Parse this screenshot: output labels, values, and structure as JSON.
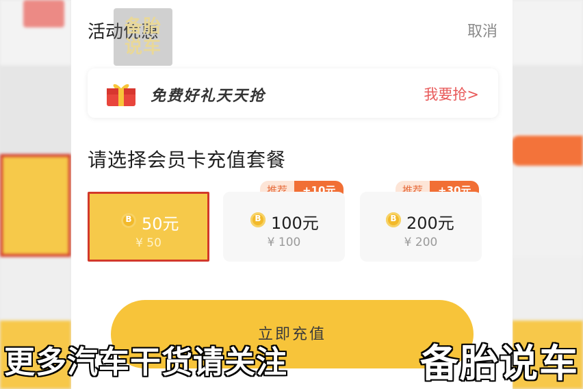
{
  "header": {
    "title": "活动优惠",
    "cancel_label": "取消"
  },
  "watermark": {
    "line1": "备胎",
    "line2": "说车"
  },
  "promo": {
    "text": "免费好礼天天抢",
    "link": "我要抢>"
  },
  "section": {
    "title": "请选择会员卡充值套餐"
  },
  "packages": [
    {
      "amount": "50元",
      "price": "¥ 50",
      "selected": true
    },
    {
      "amount": "100元",
      "price": "¥ 100",
      "tag": "推荐",
      "bonus": "+10元"
    },
    {
      "amount": "200元",
      "price": "¥ 200",
      "tag": "推荐",
      "bonus": "+30元"
    }
  ],
  "cta": {
    "label": "立即充值"
  },
  "caption": {
    "left": "更多汽车干货请关注",
    "right": "备胎说车"
  },
  "colors": {
    "accent": "#f7c43a",
    "selected_border": "#d2382a",
    "tag_orange": "#f16f35",
    "link_red": "#e85a5a"
  },
  "icons": [
    "gift-icon",
    "coin-icon"
  ]
}
